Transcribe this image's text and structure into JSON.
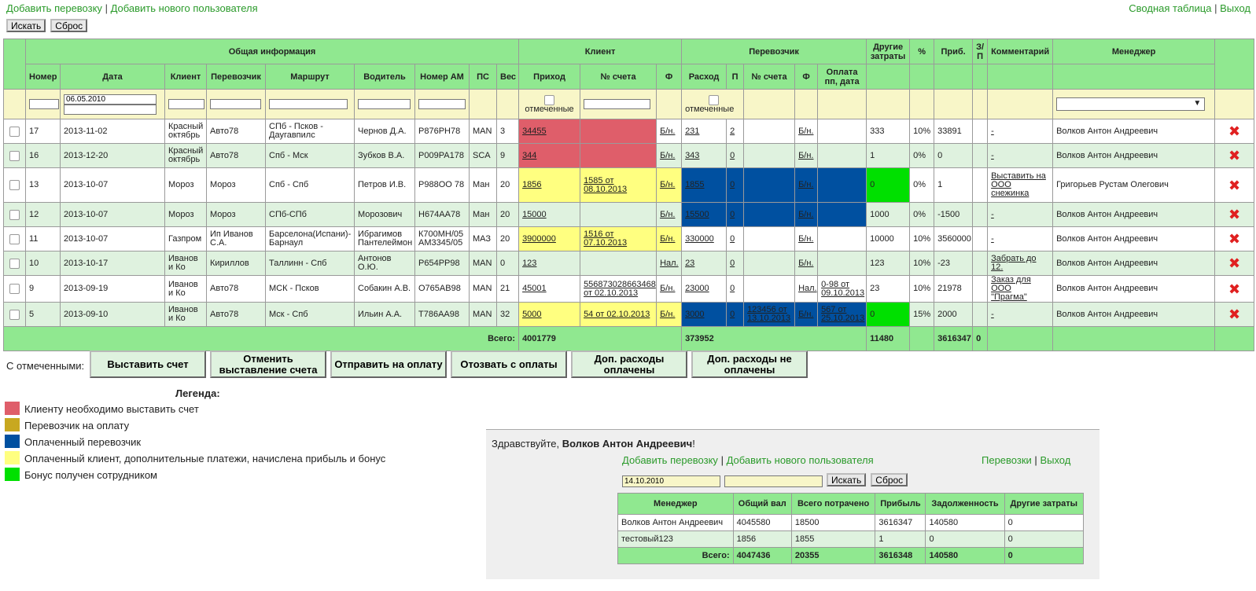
{
  "nav": {
    "add_shipment": "Добавить перевозку",
    "add_user": "Добавить нового пользователя",
    "summary_table": "Сводная таблица",
    "logout": "Выход",
    "sep": "|"
  },
  "search": {
    "search_label": "Искать",
    "reset_label": "Сброс"
  },
  "main_table": {
    "group_headers": {
      "general": "Общая информация",
      "client": "Клиент",
      "carrier": "Перевозчик",
      "other_costs": "Другие затраты",
      "percent": "%",
      "profit": "Приб.",
      "zp": "З/П",
      "comment": "Комментарий",
      "manager": "Менеджер"
    },
    "columns": {
      "number": "Номер",
      "date": "Дата",
      "client": "Клиент",
      "carrier": "Перевозчик",
      "route": "Маршрут",
      "driver": "Водитель",
      "plate": "Номер АМ",
      "ps": "ПС",
      "weight": "Вес",
      "income": "Приход",
      "invoice": "№ счета",
      "f": "Ф",
      "expense": "Расход",
      "p": "П",
      "c_invoice": "№ счета",
      "cf": "Ф",
      "payment": "Оплата пп, дата"
    },
    "filter": {
      "date_value": "06.05.2010",
      "marked": "отмеченные"
    },
    "rows": [
      {
        "num": "17",
        "date": "2013-11-02",
        "client": "Красный октябрь",
        "carrier": "Авто78",
        "route": "СПб - Псков - Даугавпилс",
        "driver": "Чернов Д.А.",
        "plate": "Р876РН78",
        "ps": "MAN",
        "weight": "3",
        "income": "34455",
        "invoice": "",
        "f": "Б/н.",
        "expense": "231",
        "p": "2",
        "c_invoice": "",
        "cf": "Б/н.",
        "payment": "",
        "other": "333",
        "pct": "10%",
        "profit": "33891",
        "zp": "",
        "comment": "-",
        "manager": "Волков Антон Андреевич"
      },
      {
        "num": "16",
        "date": "2013-12-20",
        "client": "Красный октябрь",
        "carrier": "Авто78",
        "route": "Спб - Мск",
        "driver": "Зубков В.А.",
        "plate": "Р009РА178",
        "ps": "SCA",
        "weight": "9",
        "income": "344",
        "invoice": "",
        "f": "Б/н.",
        "expense": "343",
        "p": "0",
        "c_invoice": "",
        "cf": "Б/н.",
        "payment": "",
        "other": "1",
        "pct": "0%",
        "profit": "0",
        "zp": "",
        "comment": "-",
        "manager": "Волков Антон Андреевич"
      },
      {
        "num": "13",
        "date": "2013-10-07",
        "client": "Мороз",
        "carrier": "Мороз",
        "route": "Спб - Спб",
        "driver": "Петров И.В.",
        "plate": "Р988ОО 78",
        "ps": "Ман",
        "weight": "20",
        "income": "1856",
        "invoice": "1585 от 08.10.2013",
        "f": "Б/н.",
        "expense": "1855",
        "p": "0",
        "c_invoice": "",
        "cf": "Б/н.",
        "payment": "",
        "other": "0",
        "pct": "0%",
        "profit": "1",
        "zp": "",
        "comment": "Выставить на ООО снежинка",
        "manager": "Григорьев Рустам Олегович"
      },
      {
        "num": "12",
        "date": "2013-10-07",
        "client": "Мороз",
        "carrier": "Мороз",
        "route": "СПб-СПб",
        "driver": "Морозович",
        "plate": "Н674АА78",
        "ps": "Ман",
        "weight": "20",
        "income": "15000",
        "invoice": "",
        "f": "Б/н.",
        "expense": "15500",
        "p": "0",
        "c_invoice": "",
        "cf": "Б/н.",
        "payment": "",
        "other": "1000",
        "pct": "0%",
        "profit": "-1500",
        "zp": "",
        "comment": "-",
        "manager": "Волков Антон Андреевич"
      },
      {
        "num": "11",
        "date": "2013-10-07",
        "client": "Газпром",
        "carrier": "Ип Иванов С.А.",
        "route": "Барселона(Испани)-Барнаул",
        "driver": "Ибрагимов Пантелеймон",
        "plate": "К700МН/05 АМ3345/05",
        "ps": "МАЗ",
        "weight": "20",
        "income": "3900000",
        "invoice": "1516 от 07.10.2013",
        "f": "Б/н.",
        "expense": "330000",
        "p": "0",
        "c_invoice": "",
        "cf": "Б/н.",
        "payment": "",
        "other": "10000",
        "pct": "10%",
        "profit": "3560000",
        "zp": "",
        "comment": "-",
        "manager": "Волков Антон Андреевич"
      },
      {
        "num": "10",
        "date": "2013-10-17",
        "client": "Иванов и Ко",
        "carrier": "Кириллов",
        "route": "Таллинн - Спб",
        "driver": "Антонов О.Ю.",
        "plate": "Р654РР98",
        "ps": "MAN",
        "weight": "0",
        "income": "123",
        "invoice": "",
        "f": "Нал.",
        "expense": "23",
        "p": "0",
        "c_invoice": "",
        "cf": "Б/н.",
        "payment": "",
        "other": "123",
        "pct": "10%",
        "profit": "-23",
        "zp": "",
        "comment": "Забрать до 12.",
        "manager": "Волков Антон Андреевич"
      },
      {
        "num": "9",
        "date": "2013-09-19",
        "client": "Иванов и Ко",
        "carrier": "Авто78",
        "route": "МСК - Псков",
        "driver": "Собакин А.В.",
        "plate": "О765АВ98",
        "ps": "MAN",
        "weight": "21",
        "income": "45001",
        "invoice": "556873028663468 от 02.10.2013",
        "f": "Б/н.",
        "expense": "23000",
        "p": "0",
        "c_invoice": "",
        "cf": "Нал.",
        "payment": "0-98 от 09.10.2013",
        "other": "23",
        "pct": "10%",
        "profit": "21978",
        "zp": "",
        "comment": "Заказ для ООО \"Прагма\"",
        "manager": "Волков Антон Андреевич"
      },
      {
        "num": "5",
        "date": "2013-09-10",
        "client": "Иванов и Ко",
        "carrier": "Авто78",
        "route": "Мск - Спб",
        "driver": "Ильин А.А.",
        "plate": "Т786АА98",
        "ps": "MAN",
        "weight": "32",
        "income": "5000",
        "invoice": "54 от 02.10.2013",
        "f": "Б/н.",
        "expense": "3000",
        "p": "0",
        "c_invoice": "123456 от 13.10.2013",
        "cf": "Б/н.",
        "payment": "567 от 25.10.2013",
        "other": "0",
        "pct": "15%",
        "profit": "2000",
        "zp": "",
        "comment": "-",
        "manager": "Волков Антон Андреевич"
      }
    ],
    "totals": {
      "label": "Всего:",
      "income": "4001779",
      "expense": "373952",
      "other": "11480",
      "profit": "3616347",
      "zp": "0"
    }
  },
  "actions": {
    "with_marked": "С отмеченными:",
    "issue_invoice": "Выставить счет",
    "cancel_invoice": "Отменить выставление счета",
    "send_payment": "Отправить на оплату",
    "recall_payment": "Отозвать с оплаты",
    "extra_paid": "Доп. расходы оплачены",
    "extra_unpaid": "Доп. расходы не оплачены"
  },
  "legend": {
    "title": "Легенда:",
    "items": [
      {
        "color": "#df5e6a",
        "text": "Клиенту необходимо выставить счет"
      },
      {
        "color": "#c8a820",
        "text": "Перевозчик на оплату"
      },
      {
        "color": "#0050a0",
        "text": "Оплаченный перевозчик"
      },
      {
        "color": "#ffff80",
        "text": "Оплаченный клиент, дополнительные платежи, начислена прибыль и бонус"
      },
      {
        "color": "#00e000",
        "text": "Бонус получен сотрудником"
      }
    ]
  },
  "panel": {
    "greeting": "Здравствуйте, ",
    "user_name": "Волков Антон Андреевич",
    "greeting_end": "!",
    "add_shipment": "Добавить перевозку",
    "add_user": "Добавить нового пользователя",
    "shipments": "Перевозки",
    "logout": "Выход",
    "date_from": "14.10.2010",
    "search_label": "Искать",
    "reset_label": "Сброс",
    "headers": [
      "Менеджер",
      "Общий вал",
      "Всего потрачено",
      "Прибыль",
      "Задолженность",
      "Другие затраты"
    ],
    "rows": [
      [
        "Волков Антон Андреевич",
        "4045580",
        "18500",
        "3616347",
        "140580",
        "0"
      ],
      [
        "тестовый123",
        "1856",
        "1855",
        "1",
        "0",
        "0"
      ]
    ],
    "totals": [
      "Всего:",
      "4047436",
      "20355",
      "3616348",
      "140580",
      "0"
    ]
  }
}
